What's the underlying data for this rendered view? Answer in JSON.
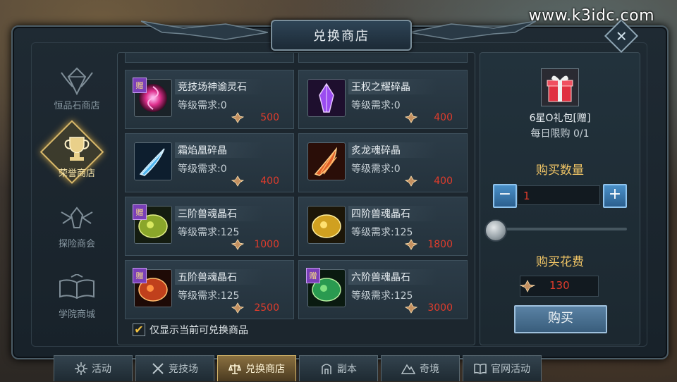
{
  "watermark": "www.k3idc.com",
  "window": {
    "title": "兑换商店"
  },
  "nav": [
    {
      "label": "恒品石商店",
      "icon": "crystal-emblem-icon",
      "active": false
    },
    {
      "label": "荣誉商店",
      "icon": "trophy-emblem-icon",
      "active": true
    },
    {
      "label": "探险商会",
      "icon": "winged-helm-emblem-icon",
      "active": false
    },
    {
      "label": "学院商城",
      "icon": "open-book-emblem-icon",
      "active": false
    }
  ],
  "items": [
    {
      "name": "竞技场神谕灵石",
      "req": "等级需求:0",
      "price": "500",
      "gift": true,
      "icon": "red-swirl-orb-icon"
    },
    {
      "name": "王权之耀碎晶",
      "req": "等级需求:0",
      "price": "400",
      "gift": false,
      "icon": "purple-crystal-shard-icon"
    },
    {
      "name": "霜焰凰碎晶",
      "req": "等级需求:0",
      "price": "400",
      "gift": false,
      "icon": "blue-feather-shard-icon"
    },
    {
      "name": "炙龙魂碎晶",
      "req": "等级需求:0",
      "price": "400",
      "gift": false,
      "icon": "red-claw-shard-icon"
    },
    {
      "name": "三阶兽魂晶石",
      "req": "等级需求:125",
      "price": "1000",
      "gift": true,
      "icon": "green-beast-stone-icon"
    },
    {
      "name": "四阶兽魂晶石",
      "req": "等级需求:125",
      "price": "1800",
      "gift": false,
      "icon": "yellow-beast-stone-icon"
    },
    {
      "name": "五阶兽魂晶石",
      "req": "等级需求:125",
      "price": "2500",
      "gift": true,
      "icon": "red-beast-stone-icon"
    },
    {
      "name": "六阶兽魂晶石",
      "req": "等级需求:125",
      "price": "3000",
      "gift": true,
      "icon": "emerald-beast-stone-icon"
    }
  ],
  "gift_label": "赠",
  "filter": {
    "label": "仅显示当前可兑换商品",
    "checked": true
  },
  "panel": {
    "item_name": "6星O礼包[赠]",
    "limit": "每日限购 0/1",
    "qty_title": "购买数量",
    "qty_value": "1",
    "minus": "−",
    "plus": "+",
    "cost_title": "购买花费",
    "cost_value": "130",
    "buy_label": "购买"
  },
  "tabs": [
    {
      "label": "活动",
      "icon": "gear-flower-icon",
      "active": false
    },
    {
      "label": "竞技场",
      "icon": "crossed-swords-icon",
      "active": false
    },
    {
      "label": "兑换商店",
      "icon": "scales-icon",
      "active": true
    },
    {
      "label": "副本",
      "icon": "dungeon-gate-icon",
      "active": false
    },
    {
      "label": "奇境",
      "icon": "mountain-icon",
      "active": false
    },
    {
      "label": "官网活动",
      "icon": "book-icon",
      "active": false
    }
  ],
  "colors": {
    "price_red": "#e03c2c",
    "gold": "#f2c666",
    "gift_purple": "#7a3fb8"
  }
}
